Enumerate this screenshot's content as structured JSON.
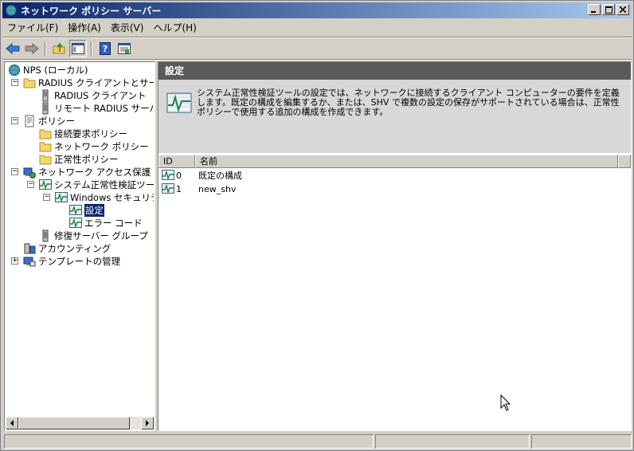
{
  "window": {
    "title": "ネットワーク ポリシー サーバー",
    "controls": {
      "minimize": "_",
      "maximize": "□",
      "close": "✕"
    }
  },
  "menubar": {
    "items": [
      "ファイル(F)",
      "操作(A)",
      "表示(V)",
      "ヘルプ(H)"
    ]
  },
  "toolbar": {
    "buttons": [
      "back-icon",
      "forward-icon",
      "up-folder-icon",
      "show-hide-tree-icon",
      "help-icon",
      "properties-icon"
    ]
  },
  "tree": {
    "root": "NPS (ローカル)",
    "radius_clients_servers": "RADIUS クライアントとサーバー",
    "radius_clients": "RADIUS クライアント",
    "remote_radius": "リモート RADIUS サーバー",
    "policies": "ポリシー",
    "connection_request_policy": "接続要求ポリシー",
    "network_policy": "ネットワーク ポリシー",
    "health_policy": "正常性ポリシー",
    "nap": "ネットワーク アクセス保護",
    "shv": "システム正常性検証ツール",
    "windows_security": "Windows セキュリティ正",
    "settings": "設定",
    "error_codes": "エラー コード",
    "remediation_groups": "修復サーバー グループ",
    "accounting": "アカウンティング",
    "template_management": "テンプレートの管理"
  },
  "right_pane": {
    "header": "設定",
    "description": "システム正常性検証ツールの設定では、ネットワークに接続するクライアント コンピューターの要件を定義します。既定の構成を編集するか、または、SHV で複数の設定の保存がサポートされている場合は、正常性ポリシーで使用する追加の構成を作成できます。",
    "columns": {
      "id": "ID",
      "name": "名前"
    },
    "rows": [
      {
        "id": "0",
        "name": "既定の構成"
      },
      {
        "id": "1",
        "name": "new_shv"
      }
    ]
  },
  "colors": {
    "titlebar_start": "#0a246a",
    "titlebar_end": "#a6caf0",
    "selection": "#0a246a",
    "pane_header": "#5a5a5a",
    "description_bg": "#d8d8d8",
    "chrome": "#d4d0c8"
  }
}
